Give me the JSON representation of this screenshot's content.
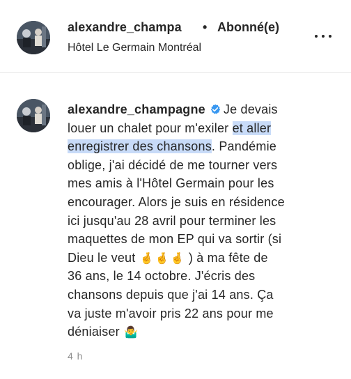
{
  "header": {
    "username": "alexandre_champa",
    "separator": "•",
    "follow_status": "Abonné(e)",
    "location": "Hôtel Le Germain Montréal"
  },
  "comment": {
    "username": "alexandre_champagne",
    "verified": true,
    "line1_text": "Je devais",
    "line2_pre": "louer un chalet pour m'exiler ",
    "line2_hl": "et aller",
    "line3_hl": "enregistrer des chansons",
    "line3_post": ". Pandémie",
    "line4": "oblige, j'ai décidé de me tourner vers",
    "line5": "mes amis à l'Hôtel Germain pour les",
    "line6": "encourager. Alors je suis en résidence",
    "line7": "ici jusqu'au 28 avril pour terminer les",
    "line8": "maquettes de mon EP qui va sortir (si",
    "line9_pre": "Dieu le veut",
    "line9_emoji": "🤞",
    "line9_post": ") à ma fête de",
    "line10": "36 ans, le 14 octobre. J'écris des",
    "line11": "chansons depuis que j'ai 14 ans. Ça",
    "line12": "va juste m'avoir pris 22 ans pour me",
    "line13_pre": "déniaiser",
    "line13_emoji": "🤷‍♂️",
    "timestamp": "4 h"
  },
  "colors": {
    "text": "#262626",
    "verified": "#3897f0",
    "highlight": "#c8dbf8",
    "muted": "#8e8e8e"
  },
  "icons": [
    "more-options-icon",
    "verified-badge-icon"
  ]
}
